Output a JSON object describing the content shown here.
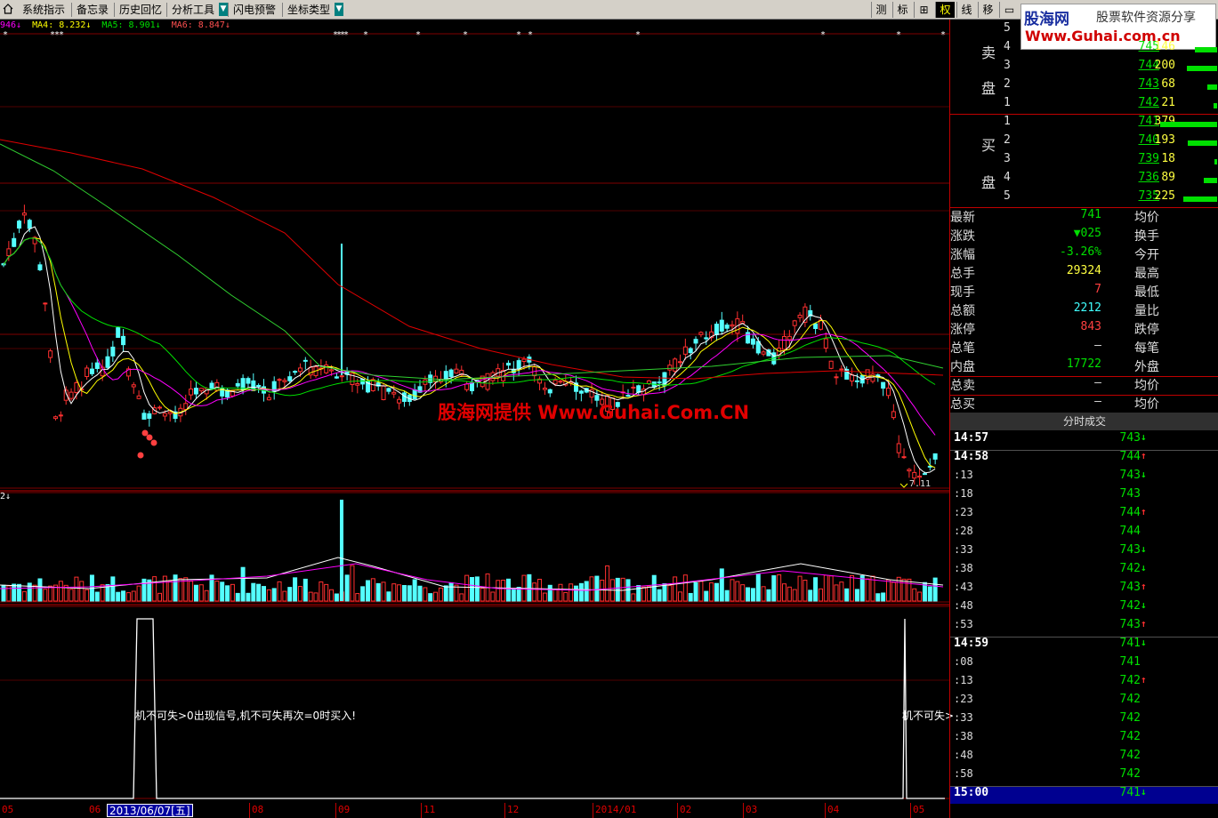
{
  "toolbar": {
    "items": [
      {
        "label": "系统指示"
      },
      {
        "label": "备忘录"
      },
      {
        "label": "历史回忆"
      },
      {
        "label": "分析工具",
        "dropdown": true
      },
      {
        "label": "闪电预警"
      },
      {
        "label": "坐标类型",
        "dropdown": true
      }
    ],
    "right_buttons": [
      {
        "label": "测",
        "active": false
      },
      {
        "label": "标",
        "active": false
      },
      {
        "label": "⊞",
        "active": false
      },
      {
        "label": "权",
        "active": true
      },
      {
        "label": "线",
        "active": false
      },
      {
        "label": "移",
        "active": false
      },
      {
        "label": "▭",
        "active": false
      }
    ]
  },
  "logo": {
    "line1_brand": "股海网",
    "line1_text": "股票软件资源分享",
    "line2": "Www.Guhai.com.cn"
  },
  "ma_legend": {
    "ma3": "946↓",
    "ma4": "MA4: 8.232↓",
    "ma5": "MA5: 8.901↓",
    "ma6": "MA6: 8.847↓"
  },
  "vol_legend": "2↓",
  "watermark": "股海网提供 Www.Guhai.Com.CN",
  "low_label": "7.11",
  "signal_texts": {
    "first": "机不可失>0出现信号,机不可失再次=0时买入!",
    "second": "机不可失>"
  },
  "date_axis": {
    "ticks": [
      "05",
      "06",
      "08",
      "09",
      "11",
      "12",
      "2014/01",
      "02",
      "03",
      "04",
      "05"
    ],
    "cursor": "2013/06/07[五]"
  },
  "order_book": {
    "sell_label_top": "卖",
    "sell_label_bottom": "盘",
    "buy_label_top": "买",
    "buy_label_bottom": "盘",
    "sell": [
      {
        "level": "5",
        "price": "",
        "volume": ""
      },
      {
        "level": "4",
        "price": "745",
        "volume": "146"
      },
      {
        "level": "3",
        "price": "744",
        "volume": "200"
      },
      {
        "level": "2",
        "price": "743",
        "volume": "68"
      },
      {
        "level": "1",
        "price": "742",
        "volume": "21"
      }
    ],
    "buy": [
      {
        "level": "1",
        "price": "741",
        "volume": "379"
      },
      {
        "level": "2",
        "price": "740",
        "volume": "193"
      },
      {
        "level": "3",
        "price": "739",
        "volume": "18"
      },
      {
        "level": "4",
        "price": "736",
        "volume": "89"
      },
      {
        "level": "5",
        "price": "735",
        "volume": "225"
      }
    ]
  },
  "quote": [
    {
      "label": "最新",
      "value": "741",
      "color": "#00e000",
      "label2": "均价"
    },
    {
      "label": "涨跌",
      "value": "▼025",
      "color": "#00e000",
      "label2": "换手"
    },
    {
      "label": "涨幅",
      "value": "-3.26%",
      "color": "#00e000",
      "label2": "今开"
    },
    {
      "label": "总手",
      "value": "29324",
      "color": "#ffff40",
      "label2": "最高"
    },
    {
      "label": "现手",
      "value": "7",
      "color": "#ff4040",
      "label2": "最低"
    },
    {
      "label": "总额",
      "value": "2212",
      "color": "#40ffff",
      "label2": "量比"
    },
    {
      "label": "涨停",
      "value": "843",
      "color": "#ff4040",
      "label2": "跌停"
    },
    {
      "label": "总笔",
      "value": "–",
      "color": "#ddd",
      "label2": "每笔"
    },
    {
      "label": "内盘",
      "value": "17722",
      "color": "#00e000",
      "label2": "外盘"
    },
    {
      "label": "总卖",
      "value": "–",
      "color": "#ddd",
      "label2": "均价"
    },
    {
      "label": "总买",
      "value": "–",
      "color": "#ddd",
      "label2": "均价"
    }
  ],
  "trades_header": "分时成交",
  "trades": [
    {
      "time": "14:57",
      "full": true,
      "price": "743",
      "dir": "down"
    },
    {
      "time": "14:58",
      "full": true,
      "price": "744",
      "dir": "up"
    },
    {
      "time": ":13",
      "full": false,
      "price": "743",
      "dir": "down"
    },
    {
      "time": ":18",
      "full": false,
      "price": "743",
      "dir": ""
    },
    {
      "time": ":23",
      "full": false,
      "price": "744",
      "dir": "up"
    },
    {
      "time": ":28",
      "full": false,
      "price": "744",
      "dir": ""
    },
    {
      "time": ":33",
      "full": false,
      "price": "743",
      "dir": "down"
    },
    {
      "time": ":38",
      "full": false,
      "price": "742",
      "dir": "down"
    },
    {
      "time": ":43",
      "full": false,
      "price": "743",
      "dir": "up"
    },
    {
      "time": ":48",
      "full": false,
      "price": "742",
      "dir": "down"
    },
    {
      "time": ":53",
      "full": false,
      "price": "743",
      "dir": "up"
    },
    {
      "time": "14:59",
      "full": true,
      "price": "741",
      "dir": "down"
    },
    {
      "time": ":08",
      "full": false,
      "price": "741",
      "dir": ""
    },
    {
      "time": ":13",
      "full": false,
      "price": "742",
      "dir": "up"
    },
    {
      "time": ":23",
      "full": false,
      "price": "742",
      "dir": ""
    },
    {
      "time": ":33",
      "full": false,
      "price": "742",
      "dir": ""
    },
    {
      "time": ":38",
      "full": false,
      "price": "742",
      "dir": ""
    },
    {
      "time": ":48",
      "full": false,
      "price": "742",
      "dir": ""
    },
    {
      "time": ":58",
      "full": false,
      "price": "742",
      "dir": ""
    },
    {
      "time": "15:00",
      "full": true,
      "price": "741",
      "dir": "down"
    }
  ],
  "colors": {
    "up": "#ff3030",
    "down": "#54ffff",
    "ma_white": "#ffffff",
    "ma_yellow": "#ffff00",
    "ma_magenta": "#ff00ff",
    "ma_green": "#00e000",
    "ma_red": "#e00000",
    "grid": "#800000"
  }
}
